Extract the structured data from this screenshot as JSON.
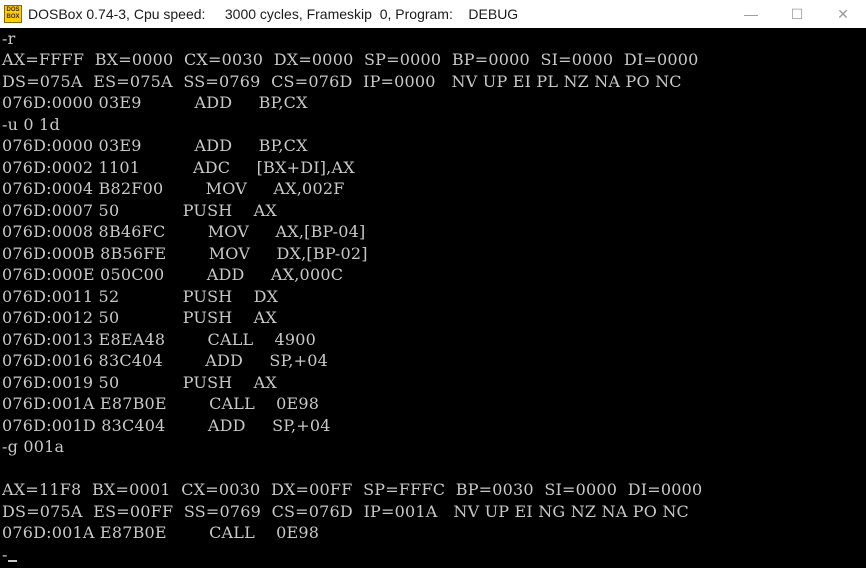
{
  "window": {
    "icon_text_top": "DOS",
    "icon_text_bottom": "BOX",
    "title": "DOSBox 0.74-3, Cpu speed:     3000 cycles, Frameskip  0, Program:    DEBUG",
    "minimize_glyph": "—",
    "maximize_glyph": "☐",
    "close_glyph": "✕"
  },
  "terminal": {
    "lines": [
      "-r",
      "AX=FFFF  BX=0000  CX=0030  DX=0000  SP=0000  BP=0000  SI=0000  DI=0000",
      "DS=075A  ES=075A  SS=0769  CS=076D  IP=0000   NV UP EI PL NZ NA PO NC",
      "076D:0000 03E9          ADD     BP,CX",
      "-u 0 1d",
      "076D:0000 03E9          ADD     BP,CX",
      "076D:0002 1101          ADC     [BX+DI],AX",
      "076D:0004 B82F00        MOV     AX,002F",
      "076D:0007 50            PUSH    AX",
      "076D:0008 8B46FC        MOV     AX,[BP-04]",
      "076D:000B 8B56FE        MOV     DX,[BP-02]",
      "076D:000E 050C00        ADD     AX,000C",
      "076D:0011 52            PUSH    DX",
      "076D:0012 50            PUSH    AX",
      "076D:0013 E8EA48        CALL    4900",
      "076D:0016 83C404        ADD     SP,+04",
      "076D:0019 50            PUSH    AX",
      "076D:001A E87B0E        CALL    0E98",
      "076D:001D 83C404        ADD     SP,+04",
      "-g 001a",
      "",
      "AX=11F8  BX=0001  CX=0030  DX=00FF  SP=FFFC  BP=0030  SI=0000  DI=0000",
      "DS=075A  ES=00FF  SS=0769  CS=076D  IP=001A   NV UP EI NG NZ NA PO NC",
      "076D:001A E87B0E        CALL    0E98",
      "-"
    ]
  }
}
